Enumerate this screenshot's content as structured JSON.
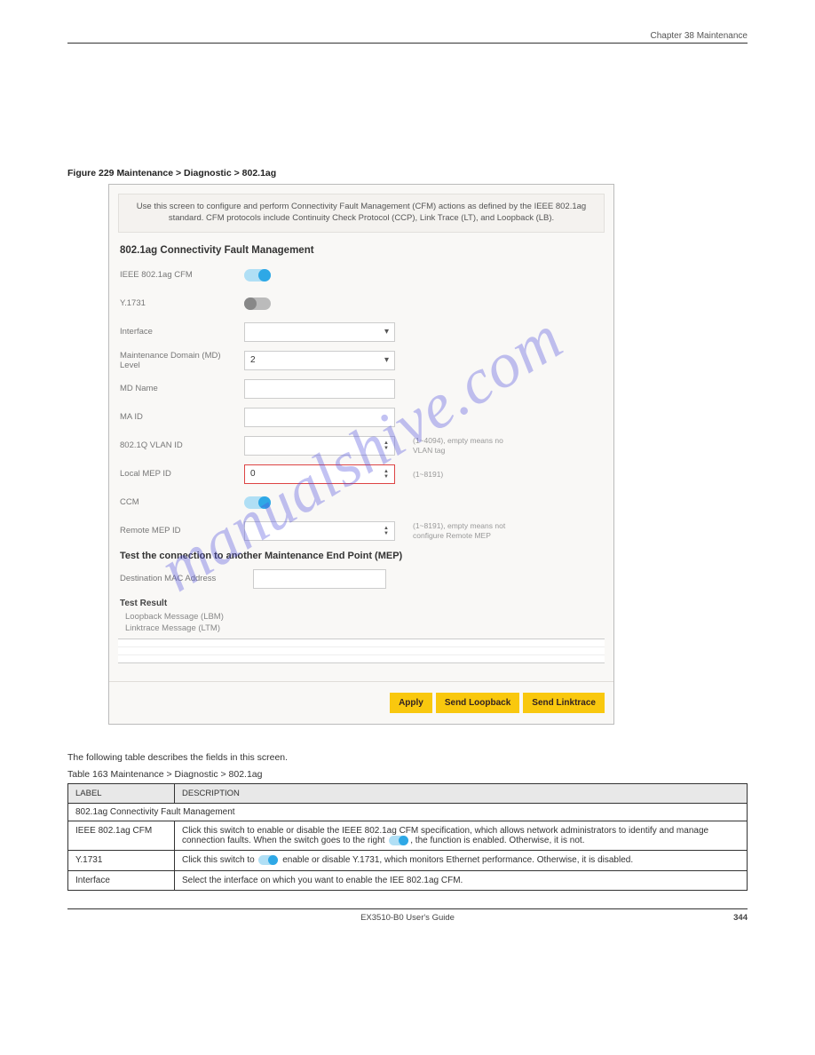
{
  "chapter": "Chapter 38 Maintenance",
  "figure_caption": "Figure 229   Maintenance > Diagnostic > 802.1ag",
  "screenshot": {
    "info": "Use this screen to configure and perform Connectivity Fault Management (CFM) actions as defined by the IEEE 802.1ag standard. CFM protocols include Continuity Check Protocol (CCP), Link Trace (LT), and Loopback (LB).",
    "heading1": "802.1ag Connectivity Fault Management",
    "fields": {
      "ieee_cfm": {
        "label": "IEEE 802.1ag CFM"
      },
      "y1731": {
        "label": "Y.1731"
      },
      "interface": {
        "label": "Interface",
        "value": ""
      },
      "md_level": {
        "label": "Maintenance Domain (MD) Level",
        "value": "2"
      },
      "md_name": {
        "label": "MD Name",
        "value": ""
      },
      "ma_id": {
        "label": "MA ID",
        "value": ""
      },
      "vlan_id": {
        "label": "802.1Q VLAN ID",
        "value": "",
        "hint": "(1~4094), empty means no VLAN tag"
      },
      "local_mep": {
        "label": "Local MEP ID",
        "value": "0",
        "hint": "(1~8191)"
      },
      "ccm": {
        "label": "CCM"
      },
      "remote_mep": {
        "label": "Remote MEP ID",
        "value": "",
        "hint": "(1~8191), empty means not configure Remote MEP"
      }
    },
    "heading2": "Test the connection to another Maintenance End Point (MEP)",
    "dest_mac": {
      "label": "Destination MAC Address",
      "value": ""
    },
    "test_result_h": "Test Result",
    "lbm": "Loopback Message (LBM)",
    "ltm": "Linktrace Message (LTM)",
    "buttons": {
      "apply": "Apply",
      "lb": "Send Loopback",
      "lt": "Send Linktrace"
    }
  },
  "watermark": "manualshive.com",
  "intro_para": "The following table describes the fields in this screen.",
  "table_caption": "Table 163   Maintenance > Diagnostic > 802.1ag",
  "tbl": {
    "h_label": "LABEL",
    "h_desc": "DESCRIPTION",
    "section": "802.1ag Connectivity Fault Management",
    "rows": [
      {
        "label": "IEEE 802.1ag CFM",
        "desc_pre": "Click this switch to enable or disable the IEEE 802.1ag CFM specification, which allows network administrators to identify and manage connection faults. When the switch goes to the right ",
        "desc_post": ", the function is enabled. Otherwise, it is not."
      },
      {
        "label": "Y.1731",
        "desc_pre": "Click this switch to ",
        "desc_post": " enable or disable Y.1731, which monitors Ethernet performance. Otherwise, it is disabled."
      },
      {
        "label": "Interface",
        "desc_pre": "Select the interface on which you want to enable the IEE 802.1ag CFM.",
        "desc_post": ""
      }
    ]
  },
  "footer": {
    "title": "EX3510-B0 User's Guide",
    "page": "344"
  }
}
